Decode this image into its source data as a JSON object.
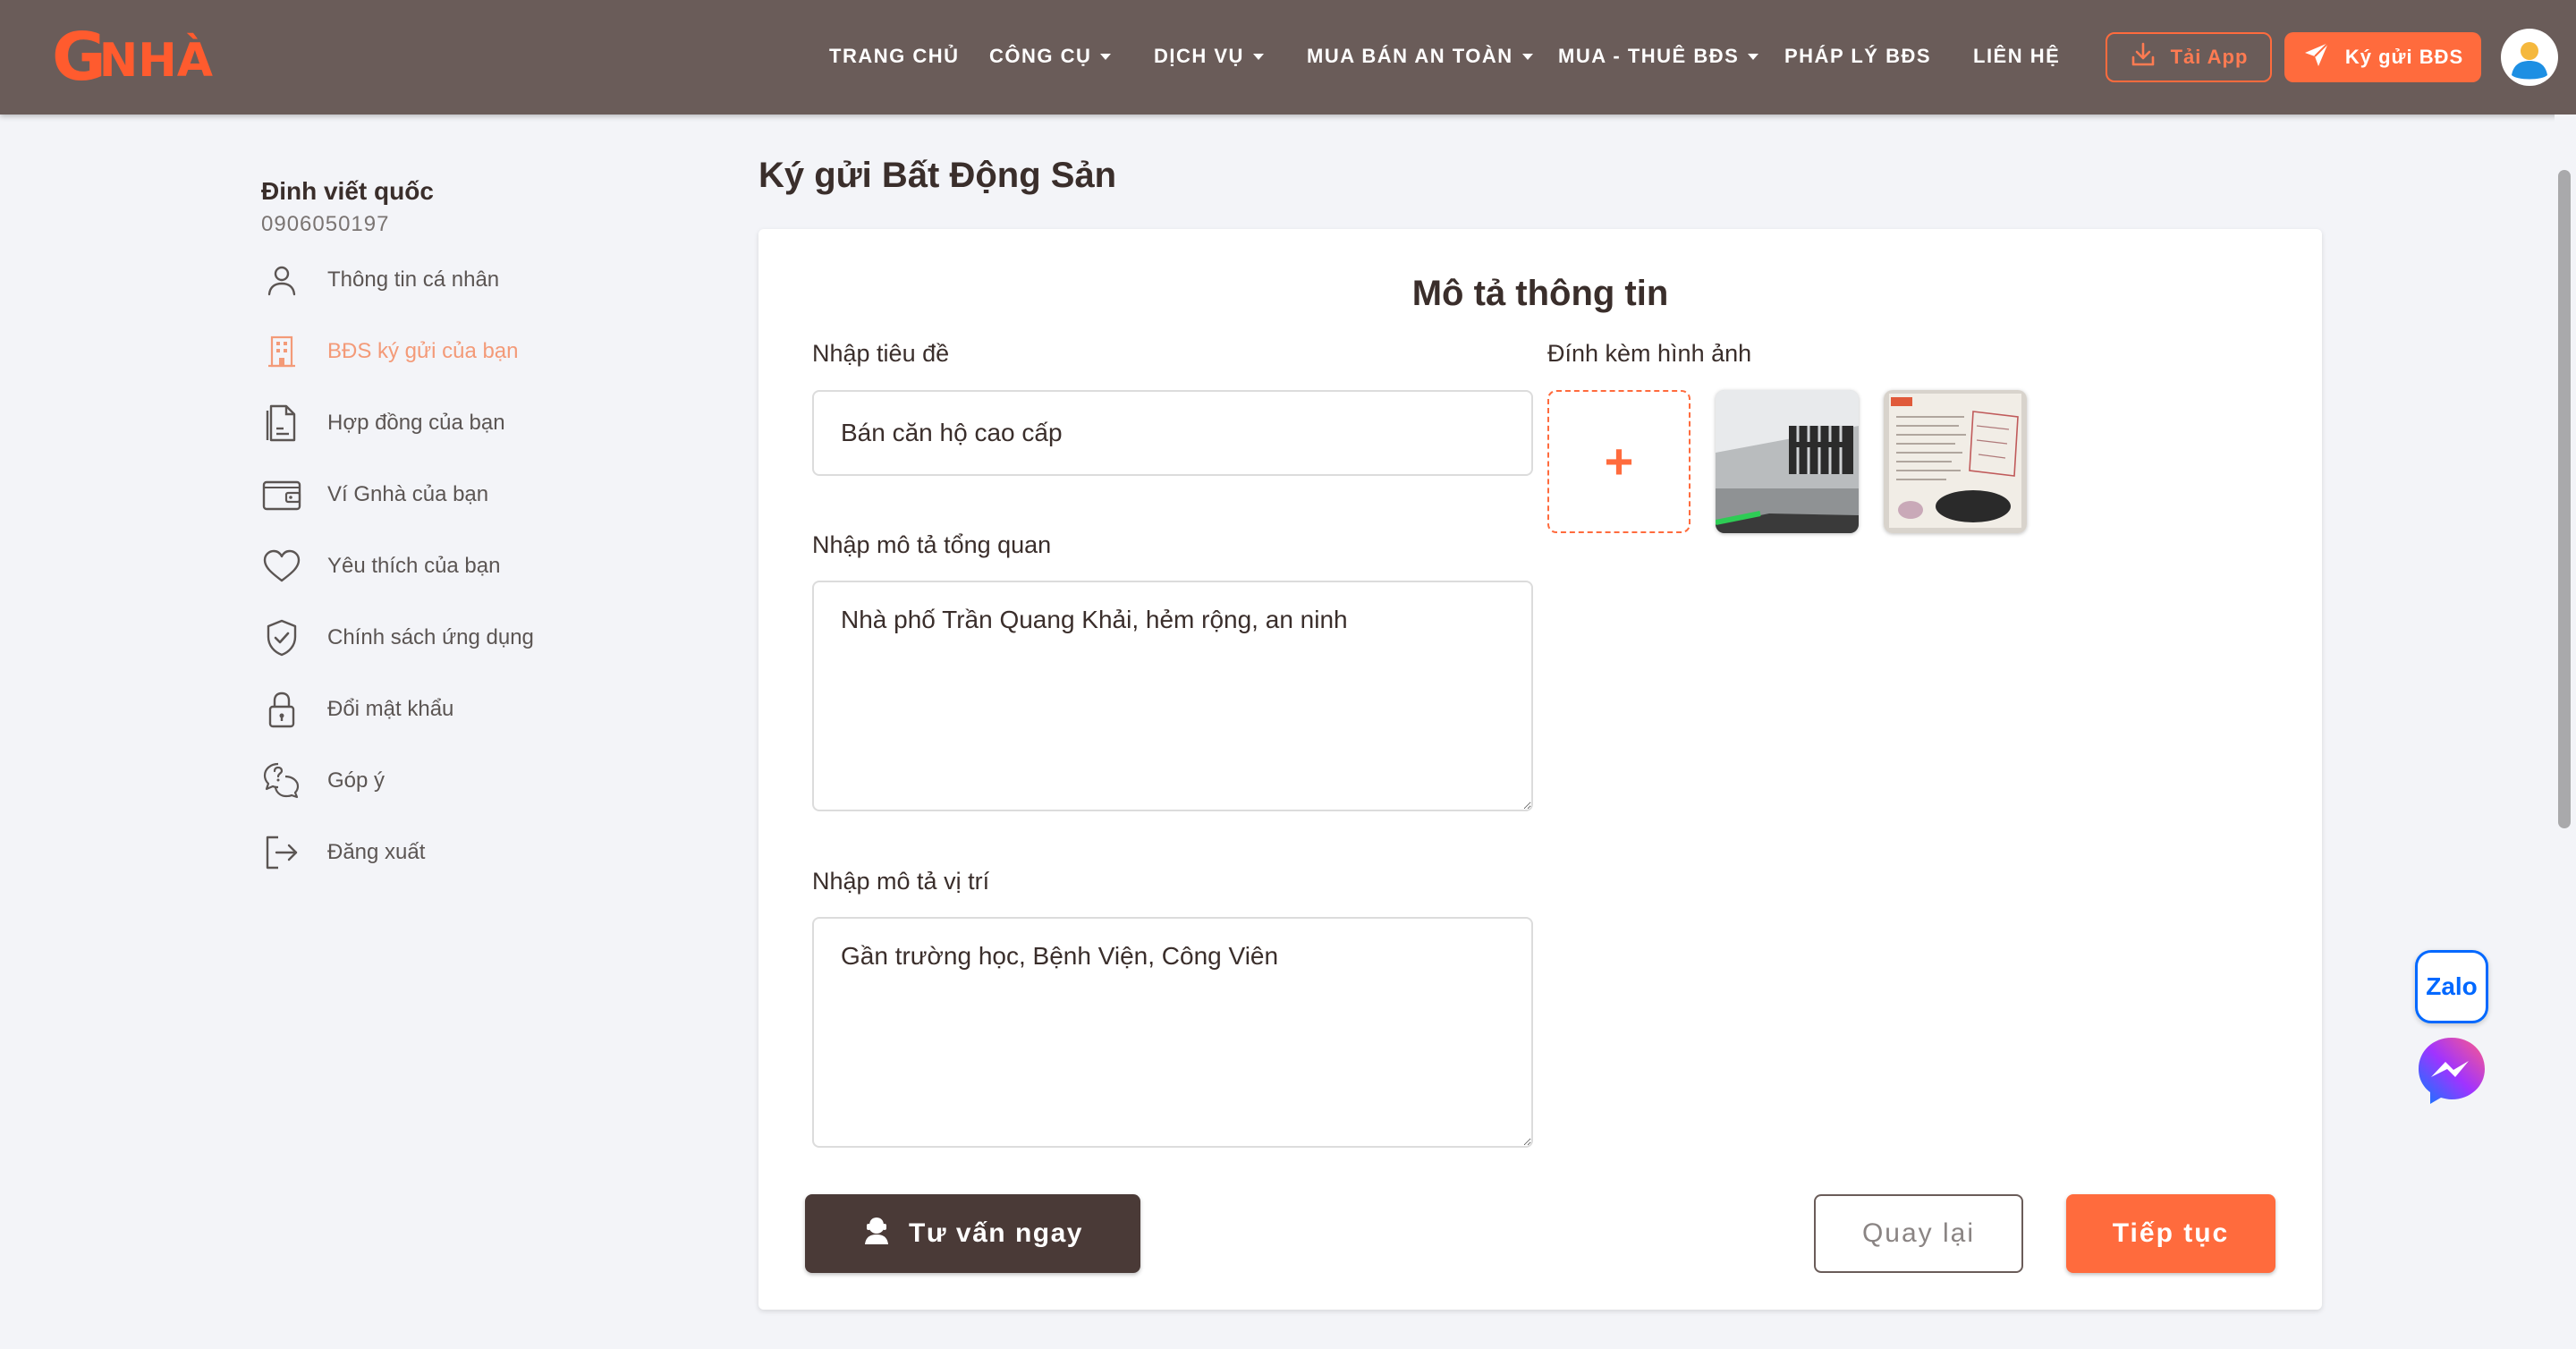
{
  "header": {
    "logo_g": "G",
    "logo_text": "NHÀ",
    "nav": [
      {
        "label": "TRANG CHỦ",
        "has_caret": false
      },
      {
        "label": "CÔNG CỤ",
        "has_caret": true
      },
      {
        "label": "DỊCH VỤ",
        "has_caret": true
      },
      {
        "label": "MUA BÁN AN TOÀN",
        "has_caret": true
      },
      {
        "label": "MUA - THUÊ BĐS",
        "has_caret": true
      },
      {
        "label": "PHÁP LÝ BĐS",
        "has_caret": false
      },
      {
        "label": "LIÊN HỆ",
        "has_caret": false
      }
    ],
    "download_app_label": "Tải App",
    "consign_label": "Ký gửi BĐS"
  },
  "sidebar": {
    "user_name": "Đinh viết quốc",
    "user_phone": "0906050197",
    "items": [
      {
        "label": "Thông tin cá nhân",
        "icon": "user-icon",
        "active": false
      },
      {
        "label": "BĐS ký gửi của bạn",
        "icon": "building-icon",
        "active": true
      },
      {
        "label": "Hợp đồng của bạn",
        "icon": "contract-icon",
        "active": false
      },
      {
        "label": "Ví Gnhà của bạn",
        "icon": "wallet-icon",
        "active": false
      },
      {
        "label": "Yêu thích của bạn",
        "icon": "heart-icon",
        "active": false
      },
      {
        "label": "Chính sách ứng dụng",
        "icon": "shield-check-icon",
        "active": false
      },
      {
        "label": "Đổi mật khẩu",
        "icon": "lock-icon",
        "active": false
      },
      {
        "label": "Góp ý",
        "icon": "feedback-icon",
        "active": false
      },
      {
        "label": "Đăng xuất",
        "icon": "logout-icon",
        "active": false
      }
    ]
  },
  "main": {
    "page_title": "Ký gửi Bất Động Sản",
    "card_title": "Mô tả thông tin",
    "title_field": {
      "label": "Nhập tiêu đề",
      "value": "Bán căn hộ cao cấp"
    },
    "overview_field": {
      "label": "Nhập mô tả tổng quan",
      "value": "Nhà phố Trần Quang Khải, hẻm rộng, an ninh"
    },
    "location_field": {
      "label": "Nhập mô tả vị trí",
      "value": "Gần trường học, Bệnh Viện, Công Viên"
    },
    "images": {
      "label": "Đính kèm hình ảnh",
      "add_symbol": "+",
      "count": 2
    },
    "consult_label": "Tư vấn ngay",
    "back_label": "Quay lại",
    "next_label": "Tiếp tục"
  },
  "floating": {
    "zalo_label": "Zalo"
  },
  "colors": {
    "accent": "#ff6b3d",
    "header_bg": "#6a5c59",
    "dark_button": "#4a3a37",
    "active_side": "#f39a78"
  }
}
